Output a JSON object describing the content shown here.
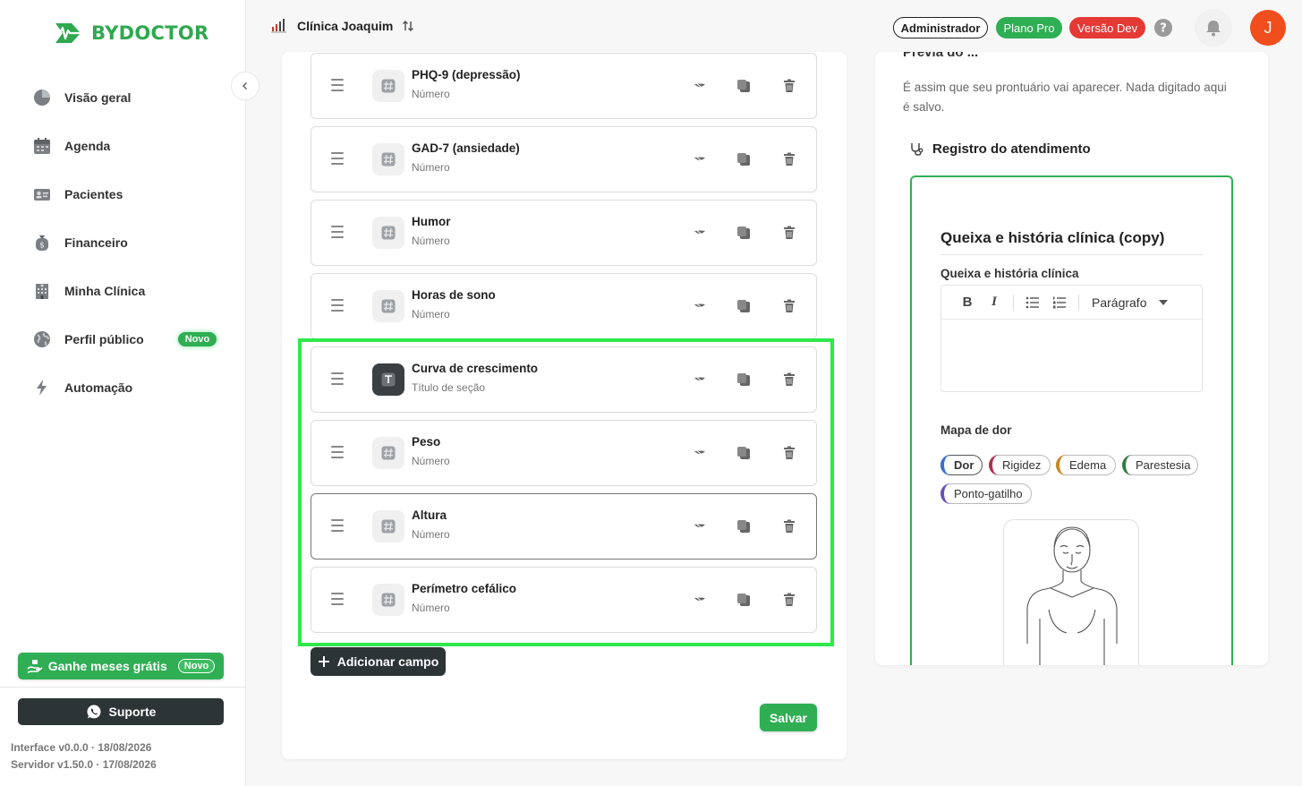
{
  "brand": {
    "name": "BYDOCTOR",
    "color": "#2fa84f"
  },
  "sidebar": {
    "items": [
      {
        "label": "Visão geral",
        "icon": "pie-chart-icon"
      },
      {
        "label": "Agenda",
        "icon": "calendar-icon"
      },
      {
        "label": "Pacientes",
        "icon": "id-card-icon"
      },
      {
        "label": "Financeiro",
        "icon": "money-bag-icon"
      },
      {
        "label": "Minha Clínica",
        "icon": "building-icon"
      },
      {
        "label": "Perfil público",
        "icon": "globe-icon",
        "badge": "Novo"
      },
      {
        "label": "Automação",
        "icon": "lightning-icon"
      }
    ],
    "promo": {
      "label": "Ganhe meses grátis",
      "badge": "Novo"
    },
    "support": {
      "label": "Suporte"
    },
    "version_interface": "Interface v0.0.0 · 18/08/2026",
    "version_server": "Servidor v1.50.0 · 17/08/2026"
  },
  "topbar": {
    "clinic": "Clínica Joaquim",
    "role": "Administrador",
    "plan": "Plano Pro",
    "env": "Versão Dev",
    "avatar_initial": "J"
  },
  "fields": [
    {
      "title": "PHQ-9 (depressão)",
      "type": "Número",
      "icon": "hash-icon"
    },
    {
      "title": "GAD-7 (ansiedade)",
      "type": "Número",
      "icon": "hash-icon"
    },
    {
      "title": "Humor",
      "type": "Número",
      "icon": "hash-icon"
    },
    {
      "title": "Horas de sono",
      "type": "Número",
      "icon": "hash-icon"
    },
    {
      "title": "Curva de crescimento",
      "type": "Título de seção",
      "icon": "text-icon"
    },
    {
      "title": "Peso",
      "type": "Número",
      "icon": "hash-icon"
    },
    {
      "title": "Altura",
      "type": "Número",
      "icon": "hash-icon"
    },
    {
      "title": "Perímetro cefálico",
      "type": "Número",
      "icon": "hash-icon"
    }
  ],
  "actions": {
    "add_field": "Adicionar campo",
    "save": "Salvar"
  },
  "preview": {
    "heading_cut": "Prévia do ...",
    "description": "É assim que seu prontuário vai aparecer. Nada digitado aqui é salvo.",
    "record_heading": "Registro do atendimento",
    "record_title": "Queixa e história clínica (copy)",
    "field_label": "Queixa e história clínica",
    "editor": {
      "bold": "B",
      "italic": "I",
      "paragraph": "Parágrafo"
    },
    "pain_map_label": "Mapa de dor",
    "chips": [
      {
        "label": "Dor",
        "color": "#3b6fd6",
        "selected": true
      },
      {
        "label": "Rigidez",
        "color": "#b0304f"
      },
      {
        "label": "Edema",
        "color": "#c98a1c"
      },
      {
        "label": "Parestesia",
        "color": "#2f7d43"
      },
      {
        "label": "Ponto-gatilho",
        "color": "#6a4fbf"
      }
    ]
  }
}
